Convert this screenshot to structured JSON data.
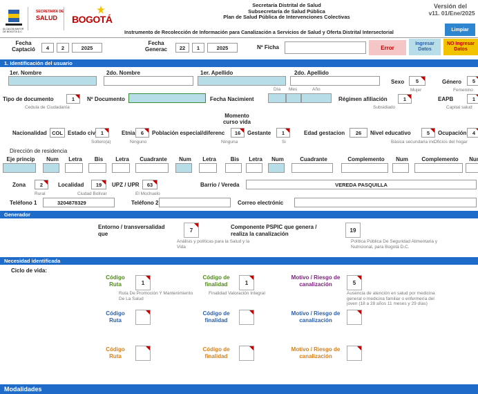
{
  "header": {
    "logo_line1": "SECRETARÍA DE",
    "logo_line2": "SALUD",
    "logo_bogota": "BOGOTÁ",
    "logo_small": "ALCALDÍA MAYOR DE BOGOTÁ D.C.",
    "title1": "Secretaría Distrital de Salud",
    "title2": "Subsecretaría de Salud Pública",
    "title3": "Plan de Salud Pública de Intervenciones Colectivas",
    "title4": "Instrumento de Recolección de Información para Canalización a Servicios de Salud y Oferta Distrital Intersectorial",
    "version1": "Versión del",
    "version2": "v11. 01/Ene/2025",
    "btn_limpiar": "Limpiar"
  },
  "dates": {
    "fecha_capt_label": "Fecha Captació",
    "capt_d": "4",
    "capt_m": "2",
    "capt_y": "2025",
    "fecha_gen_label": "Fecha Generac",
    "gen_d": "22",
    "gen_m": "1",
    "gen_y": "2025",
    "ficha_label": "Nº Ficha",
    "error": "Error",
    "ingresar": "Ingresar Datos",
    "no_ingresar": "NO Ingresar Datos"
  },
  "sections": {
    "s1": "1. Identificación del usuario",
    "gen": "Generador",
    "nec": "Necesidad identificada",
    "mod": "Modalidades"
  },
  "user": {
    "nombre1": "1er. Nombre",
    "nombre2": "2do. Nombre",
    "apellido1": "1er. Apellido",
    "apellido2": "2do. Apellido",
    "sexo_label": "Sexo",
    "sexo_val": "5",
    "sexo_sub": "Mujer",
    "genero_label": "Género",
    "genero_val": "5",
    "genero_sub": "Femenino",
    "tipo_doc_label": "Tipo de documento",
    "tipo_doc_val": "1",
    "tipo_doc_sub": "Cedula de Ciudadanía",
    "num_doc_label": "Nº Documento",
    "fecha_nac_label": "Fecha Nacimient",
    "dia": "Día",
    "mes": "Mes",
    "anio": "Año",
    "regimen_label": "Régimen afiliación",
    "regimen_val": "1",
    "regimen_sub": "Subsidiado",
    "eapb_label": "EAPB",
    "eapb_val": "1",
    "eapb_sub": "Capital salud",
    "momento_label": "Momento curso vida",
    "nac_label": "Nacionalidad",
    "nac_val": "COL",
    "civil_label": "Estado civil",
    "civil_val": "1",
    "civil_sub": "Soltero(a)",
    "etnia_label": "Etnia",
    "etnia_val": "6",
    "etnia_sub": "Ninguno",
    "pob_label": "Población especial/diferenc",
    "pob_val": "16",
    "pob_sub": "Ninguna",
    "gest_label": "Gestante",
    "gest_val": "1",
    "gest_sub": "Si",
    "edad_gest_label": "Edad gestacion",
    "edad_gest_val": "26",
    "niv_label": "Nivel educativo",
    "niv_val": "5",
    "niv_sub": "Básica secundaria inc",
    "ocup_label": "Ocupación",
    "ocup_val": "4",
    "ocup_sub": "Oficios del hogar",
    "dir_label": "Dirección de residencia",
    "dir_cols": [
      "Eje princip",
      "Num",
      "Letra",
      "Bis",
      "Letra",
      "Cuadrante",
      "Num",
      "Letra",
      "Bis",
      "Letra",
      "Num",
      "Cuadrante",
      "Complemento",
      "Num",
      "Complemento",
      "Num"
    ],
    "zona_label": "Zona",
    "zona_val": "2",
    "zona_sub": "Rural",
    "loc_label": "Localidad",
    "loc_val": "19",
    "loc_sub": "Ciudad Bolívar",
    "upz_label": "UPZ / UPR",
    "upz_val": "63",
    "upz_sub": "El Mochuelo",
    "barrio_label": "Barrio / Vereda",
    "barrio_val": "VEREDA PASQUILLA",
    "tel1_label": "Teléfono 1",
    "tel1_val": "3204878329",
    "tel2_label": "Teléfono 2",
    "email_label": "Correo electrónic"
  },
  "generador": {
    "entorno_label": "Entorno / transversalidad que",
    "entorno_val": "7",
    "entorno_sub": "Análisis y políticas para la Salud y la Vida",
    "comp_label": "Componente PSPIC que genera / realiza la canalización",
    "comp_val": "19",
    "comp_sub": "Política Pública De Seguridad Alimentaria y Nutricional, para Bogotá D.C."
  },
  "necesidad": {
    "ciclo_label": "Ciclo de vida:",
    "row1": {
      "codigo_label": "Código Ruta",
      "codigo_val": "1",
      "codigo_sub": "Ruta De Promoción Y Mantenimiento De La Salud",
      "finalidad_label": "Código de finalidad",
      "finalidad_val": "1",
      "finalidad_sub": "Finalidad Valoración Integral",
      "motivo_label": "Motivo / Riesgo de canalización",
      "motivo_val": "5",
      "motivo_sub": "Ausencia de atención en salud por medicina general o medicina familiar o enfermería del joven (18 a 28 años 11 meses y 29 días)"
    },
    "row2": {
      "codigo_label": "Código Ruta",
      "finalidad_label": "Código de finalidad",
      "motivo_label": "Motivo / Riesgo de canalización"
    },
    "row3": {
      "codigo_label": "Código Ruta",
      "finalidad_label": "Código de finalidad",
      "motivo_label": "Motivo / Riesgo de canalización"
    }
  }
}
